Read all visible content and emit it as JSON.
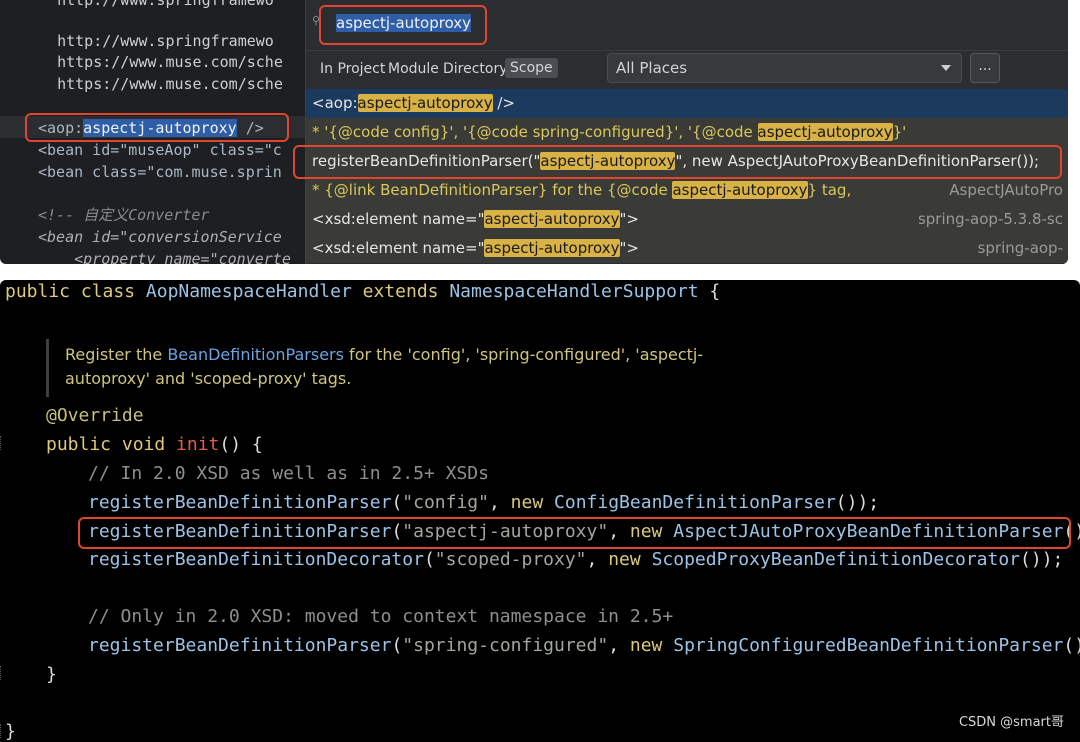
{
  "editor": {
    "lines": [
      "   http://www.springframewo",
      "   http://www.springframewo",
      "   https://www.muse.com/sche",
      "   https://www.muse.com/sche",
      "",
      "<aop:aspectj-autoproxy />",
      "<bean id=\"museAop\" class=\"c",
      "<bean class=\"com.muse.sprin",
      "",
      "<!-- 自定义Converter",
      "<bean id=\"conversionService",
      "    <property name=\"converte"
    ],
    "aop_prefix": "<aop:",
    "aop_selected": "aspectj-autoproxy",
    "aop_suffix": " />"
  },
  "popup": {
    "search_value": "aspectj-autoproxy",
    "tabs": [
      "In Project",
      "Module",
      "Directory",
      "Scope"
    ],
    "places": "All Places",
    "more_label": "...",
    "results": [
      {
        "pre": "<aop:",
        "hl": "aspectj-autoproxy",
        "post": " />",
        "file": ""
      },
      {
        "pre": "* '{@code config}', '{@code spring-configured}', '{@code ",
        "hl": "aspectj-autoproxy",
        "post": "}'",
        "file": ""
      },
      {
        "pre": "registerBeanDefinitionParser(\"",
        "hl": "aspectj-autoproxy",
        "post": "\", new AspectJAutoProxyBeanDefinitionParser());",
        "file": ""
      },
      {
        "pre": "* {@link BeanDefinitionParser} for the {@code ",
        "hl": "aspectj-autoproxy",
        "post": "} tag,",
        "file": "AspectJAutoPro"
      },
      {
        "pre": "<xsd:element name=\"",
        "hl": "aspectj-autoproxy",
        "post": "\">",
        "file": "spring-aop-5.3.8-sc"
      },
      {
        "pre": "<xsd:element name=\"",
        "hl": "aspectj-autoproxy",
        "post": "\">",
        "file": "spring-aop-"
      }
    ]
  },
  "code": {
    "class_kw": "public class ",
    "class_name": "AopNamespaceHandler",
    "extends_kw": " extends ",
    "super_name": "NamespaceHandlerSupport",
    "brace_open": " {",
    "doc_1": "Register the ",
    "doc_link": "BeanDefinitionParsers",
    "doc_2": " for the 'config', 'spring-configured', 'aspectj-",
    "doc_3": "autoproxy' and 'scoped-proxy' tags.",
    "annotation": "@Override",
    "method_kw": "public void ",
    "method_name": "init",
    "method_tail": "() {",
    "comment_1": "// In 2.0 XSD as well as in 2.5+ XSDs",
    "calls": [
      {
        "fn": "registerBeanDefinitionParser",
        "arg": "\"config\"",
        "cls": "ConfigBeanDefinitionParser"
      },
      {
        "fn": "registerBeanDefinitionParser",
        "arg": "\"aspectj-autoproxy\"",
        "cls": "AspectJAutoProxyBeanDefinitionParser"
      },
      {
        "fn": "registerBeanDefinitionDecorator",
        "arg": "\"scoped-proxy\"",
        "cls": "ScopedProxyBeanDefinitionDecorator"
      }
    ],
    "comment_2": "// Only in 2.0 XSD: moved to context namespace in 2.5+",
    "call_last": {
      "fn": "registerBeanDefinitionParser",
      "arg": "\"spring-configured\"",
      "cls": "SpringConfiguredBeanDefinitionParser"
    },
    "new_kw": "new",
    "close_inner": "}",
    "close_outer": "}"
  },
  "watermark": "CSDN @smart哥",
  "colors": {
    "highlight": "#d8b245",
    "red_box": "#e0462e",
    "selection": "#2f5ea8"
  }
}
